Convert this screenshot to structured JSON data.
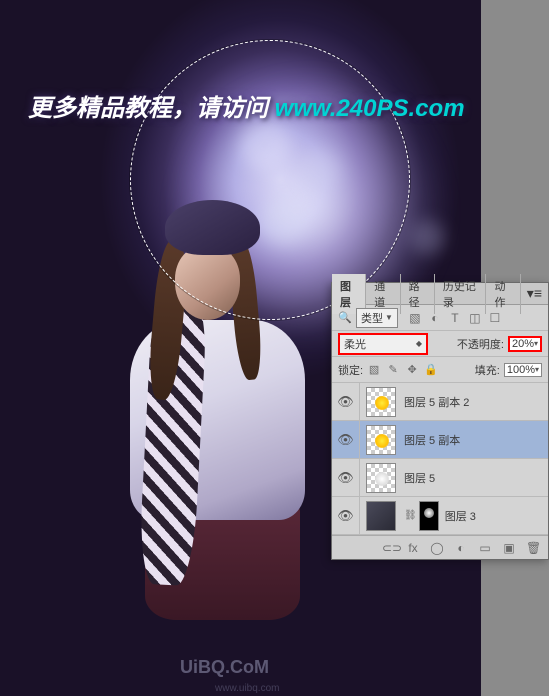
{
  "watermark": {
    "main_text": "更多精品教程，请访问 ",
    "url": "www.240PS.com",
    "bottom": "UiBQ.CoM",
    "sub": "www.uibq.com"
  },
  "panel": {
    "tabs": {
      "layers": "图层",
      "channels": "通道",
      "paths": "路径",
      "history": "历史记录",
      "actions": "动作"
    },
    "type_label": "类型",
    "blend_mode": "柔光",
    "opacity_label": "不透明度:",
    "opacity_value": "20%",
    "lock_label": "锁定:",
    "fill_label": "填充:",
    "fill_value": "100%"
  },
  "layers": [
    {
      "name": "图层 5 副本 2"
    },
    {
      "name": "图层 5 副本"
    },
    {
      "name": "图层 5"
    },
    {
      "name": "图层 3"
    }
  ]
}
